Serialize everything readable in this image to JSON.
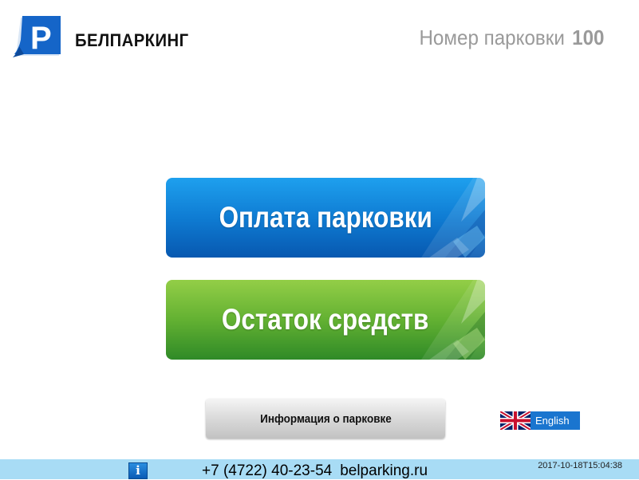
{
  "header": {
    "logo_letter": "P",
    "brand": "БЕЛПАРКИНГ",
    "parking_label": "Номер парковки",
    "parking_number": "100"
  },
  "buttons": {
    "pay_parking": "Оплата парковки",
    "balance": "Остаток средств",
    "info": "Информация о парковке",
    "language": "English"
  },
  "footer": {
    "phone": "+7 (4722) 40-23-54",
    "site": "belparking.ru",
    "timestamp": "2017-10-18T15:04:38",
    "info_icon_letter": "i"
  },
  "colors": {
    "logo_blue": "#1565c8",
    "pay_button": "#0f7cd3",
    "balance_button": "#63b132",
    "footer_bar": "#a8dcf5"
  }
}
